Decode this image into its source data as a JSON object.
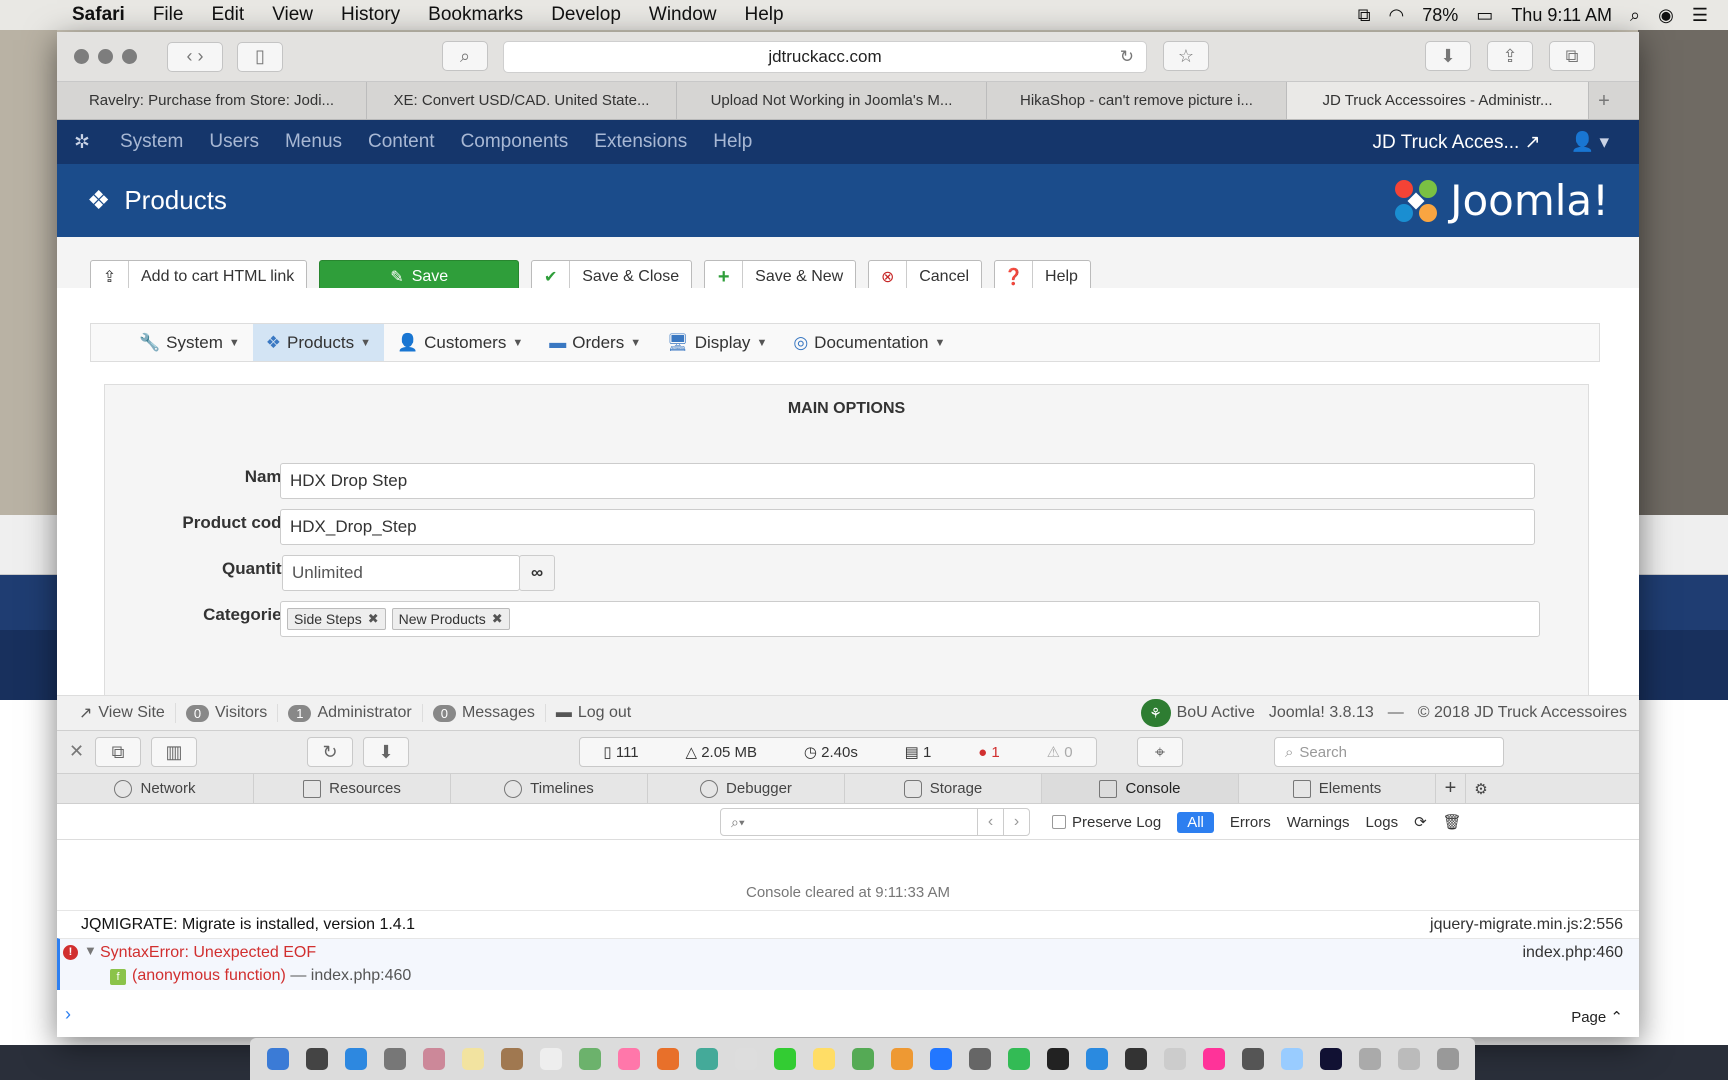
{
  "menubar": {
    "app": "Safari",
    "items": [
      "File",
      "Edit",
      "View",
      "History",
      "Bookmarks",
      "Develop",
      "Window",
      "Help"
    ],
    "battery": "78%",
    "clock": "Thu 9:11 AM"
  },
  "browser": {
    "url": "jdtruckacc.com",
    "tabs": [
      "Ravelry: Purchase from Store: Jodi...",
      "XE: Convert USD/CAD. United State...",
      "Upload Not Working in Joomla's M...",
      "HikaShop - can't remove picture i...",
      "JD Truck Accessoires - Administr..."
    ]
  },
  "joomla": {
    "nav": [
      "System",
      "Users",
      "Menus",
      "Content",
      "Components",
      "Extensions",
      "Help"
    ],
    "site_name": "JD Truck Acces...",
    "page_title": "Products",
    "brand": "Joomla!",
    "actions": {
      "add_to_cart": "Add to cart HTML link",
      "save": "Save",
      "save_close": "Save & Close",
      "save_new": "Save & New",
      "cancel": "Cancel",
      "help": "Help"
    },
    "hika_nav": [
      {
        "label": "System",
        "icon": "wrench-icon"
      },
      {
        "label": "Products",
        "icon": "cubes-icon"
      },
      {
        "label": "Customers",
        "icon": "user-icon"
      },
      {
        "label": "Orders",
        "icon": "credit-card-icon"
      },
      {
        "label": "Display",
        "icon": "monitor-icon"
      },
      {
        "label": "Documentation",
        "icon": "lifebuoy-icon"
      }
    ],
    "panel_title": "MAIN OPTIONS",
    "fields": {
      "name_label": "Name",
      "name_value": "HDX Drop Step",
      "code_label": "Product code",
      "code_value": "HDX_Drop_Step",
      "qty_label": "Quantity",
      "qty_value": "Unlimited",
      "cat_label": "Categories",
      "categories": [
        "Side Steps",
        "New Products"
      ]
    },
    "status": {
      "view_site": "View Site",
      "visitors_count": "0",
      "visitors": "Visitors",
      "admin_count": "1",
      "admin": "Administrator",
      "messages_count": "0",
      "messages": "Messages",
      "logout": "Log out",
      "bou": "BoU Active",
      "version": "Joomla! 3.8.13",
      "copyright": "© 2018 JD Truck Accessoires"
    }
  },
  "devtools": {
    "metrics": {
      "requests": "111",
      "size": "2.05 MB",
      "time": "2.40s",
      "logs": "1",
      "errors": "1",
      "warnings": "0"
    },
    "search_placeholder": "Search",
    "tabs": [
      "Network",
      "Resources",
      "Timelines",
      "Debugger",
      "Storage",
      "Console",
      "Elements"
    ],
    "filter": {
      "preserve_log": "Preserve Log",
      "all": "All",
      "errors": "Errors",
      "warnings": "Warnings",
      "logs": "Logs"
    },
    "console": {
      "cleared": "Console cleared at 9:11:33 AM",
      "log_msg": "JQMIGRATE: Migrate is installed, version 1.4.1",
      "log_src": "jquery-migrate.min.js:2:556",
      "error_msg": "SyntaxError: Unexpected EOF",
      "error_src": "index.php:460",
      "fn_name": "(anonymous function)",
      "fn_loc": "index.php:460",
      "page_label": "Page"
    }
  }
}
